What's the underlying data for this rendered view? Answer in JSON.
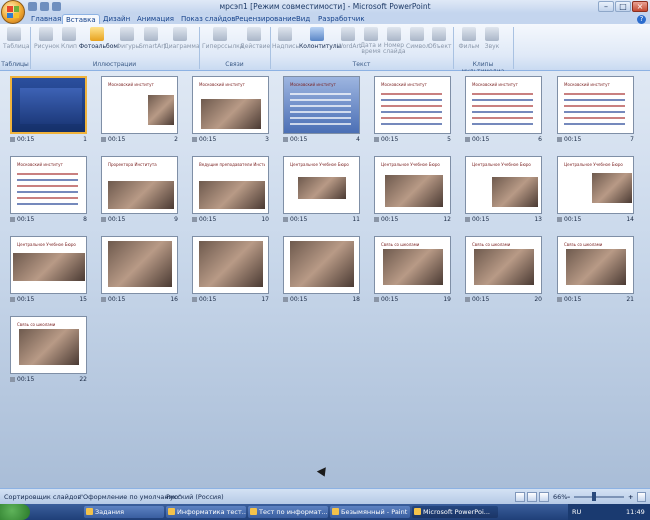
{
  "window": {
    "title": "мрсэп1 [Режим совместимости] - Microsoft PowerPoint"
  },
  "ribbon": {
    "tabs": [
      "Главная",
      "Вставка",
      "Дизайн",
      "Анимация",
      "Показ слайдов",
      "Рецензирование",
      "Вид",
      "Разработчик"
    ],
    "active_tab": "Вставка",
    "buttons": [
      {
        "label": "Таблица",
        "icon": "table-icon",
        "enabled": false
      },
      {
        "label": "Рисунок",
        "icon": "picture-icon",
        "enabled": false
      },
      {
        "label": "Клип",
        "icon": "clipart-icon",
        "enabled": false
      },
      {
        "label": "Фотоальбом",
        "icon": "photo-album-icon",
        "enabled": true
      },
      {
        "label": "Фигуры",
        "icon": "shapes-icon",
        "enabled": false
      },
      {
        "label": "SmartArt",
        "icon": "smartart-icon",
        "enabled": false
      },
      {
        "label": "Диаграмма",
        "icon": "chart-icon",
        "enabled": false
      },
      {
        "label": "Гиперссылка",
        "icon": "hyperlink-icon",
        "enabled": false
      },
      {
        "label": "Действие",
        "icon": "action-icon",
        "enabled": false
      },
      {
        "label": "Надпись",
        "icon": "textbox-icon",
        "enabled": false
      },
      {
        "label": "Колонтитулы",
        "icon": "header-footer-icon",
        "enabled": true
      },
      {
        "label": "WordArt",
        "icon": "wordart-icon",
        "enabled": false
      },
      {
        "label": "Дата и время",
        "icon": "date-time-icon",
        "enabled": false
      },
      {
        "label": "Номер слайда",
        "icon": "slide-number-icon",
        "enabled": false
      },
      {
        "label": "Символ",
        "icon": "symbol-icon",
        "enabled": false
      },
      {
        "label": "Объект",
        "icon": "object-icon",
        "enabled": false
      },
      {
        "label": "Фильм",
        "icon": "movie-icon",
        "enabled": false
      },
      {
        "label": "Звук",
        "icon": "sound-icon",
        "enabled": false
      }
    ],
    "groups": [
      "Таблицы",
      "Иллюстрации",
      "Связи",
      "Текст",
      "Клипы мультимедиа"
    ]
  },
  "slides": [
    {
      "num": "1",
      "time": "00:15",
      "heading": "ОБРАЗОВАНИЯ"
    },
    {
      "num": "2",
      "time": "00:15",
      "heading": "Московский институт"
    },
    {
      "num": "3",
      "time": "00:15",
      "heading": "Московский институт"
    },
    {
      "num": "4",
      "time": "00:15",
      "heading": "Московский институт"
    },
    {
      "num": "5",
      "time": "00:15",
      "heading": "Московский институт"
    },
    {
      "num": "6",
      "time": "00:15",
      "heading": "Московский институт"
    },
    {
      "num": "7",
      "time": "00:15",
      "heading": "Московский институт"
    },
    {
      "num": "8",
      "time": "00:15",
      "heading": "Московский институт"
    },
    {
      "num": "9",
      "time": "00:15",
      "heading": "Проректора Института"
    },
    {
      "num": "10",
      "time": "00:15",
      "heading": "Ведущие преподаватели Института"
    },
    {
      "num": "11",
      "time": "00:15",
      "heading": "Центральное Учебное Бюро"
    },
    {
      "num": "12",
      "time": "00:15",
      "heading": "Центральное Учебное Бюро"
    },
    {
      "num": "13",
      "time": "00:15",
      "heading": "Центральное Учебное Бюро"
    },
    {
      "num": "14",
      "time": "00:15",
      "heading": "Центральное Учебное Бюро"
    },
    {
      "num": "15",
      "time": "00:15",
      "heading": "Центральное Учебное Бюро"
    },
    {
      "num": "16",
      "time": "00:15",
      "heading": ""
    },
    {
      "num": "17",
      "time": "00:15",
      "heading": ""
    },
    {
      "num": "18",
      "time": "00:15",
      "heading": ""
    },
    {
      "num": "19",
      "time": "00:15",
      "heading": "Связь со школами"
    },
    {
      "num": "20",
      "time": "00:15",
      "heading": "Связь со школами"
    },
    {
      "num": "21",
      "time": "00:15",
      "heading": "Связь со школами"
    },
    {
      "num": "22",
      "time": "00:15",
      "heading": "Связь со школами"
    }
  ],
  "statusbar": {
    "view": "Сортировщик слайдов",
    "theme": "\"Оформление по умолчанию\"",
    "language": "Русский (Россия)",
    "zoom": "66%",
    "zoom_fraction": 0.4
  },
  "taskbar": {
    "items": [
      {
        "label": "Задания",
        "active": false
      },
      {
        "label": "Информатика тест...",
        "active": false
      },
      {
        "label": "Тест по информат...",
        "active": false
      },
      {
        "label": "Безымянный - Paint",
        "active": false
      },
      {
        "label": "Microsoft PowerPoi...",
        "active": true
      }
    ],
    "lang": "RU",
    "clock": "11:49"
  },
  "colors": {
    "accent": "#f0b33c",
    "ribbon_blue": "#15428b",
    "taskbar": "#1f3f78"
  }
}
